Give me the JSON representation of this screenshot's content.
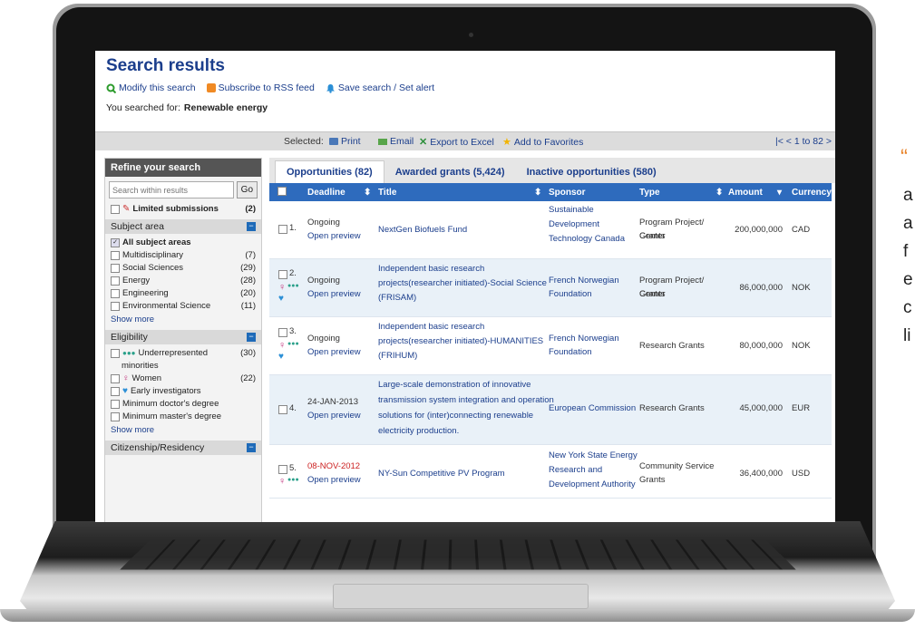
{
  "page": {
    "title": "Search results",
    "links": [
      "Modify this search",
      "Subscribe to RSS feed",
      "Save search / Set alert"
    ],
    "searched_for_label": "You searched for:",
    "searched_for_value": "Renewable energy"
  },
  "selbar": {
    "label": "Selected:",
    "actions": [
      "Print",
      "Email",
      "Export to Excel",
      "Add to Favorites"
    ],
    "pager": "|<  <  1 to 82  >"
  },
  "sidebar": {
    "heading": "Refine your search",
    "search_placeholder": "Search within results",
    "go": "Go",
    "limited": {
      "label": "Limited submissions",
      "count": "(2)"
    },
    "subject_area": {
      "title": "Subject area",
      "all": "All subject areas",
      "items": [
        {
          "label": "Multidisciplinary",
          "count": "(7)"
        },
        {
          "label": "Social Sciences",
          "count": "(29)"
        },
        {
          "label": "Energy",
          "count": "(28)"
        },
        {
          "label": "Engineering",
          "count": "(20)"
        },
        {
          "label": "Environmental Science",
          "count": "(11)"
        }
      ],
      "show_more": "Show more"
    },
    "eligibility": {
      "title": "Eligibility",
      "items": [
        {
          "label": "Underrepresented",
          "label2": "minorities",
          "count": "(30)"
        },
        {
          "label": "Women",
          "count": "(22)"
        },
        {
          "label": "Early investigators",
          "count": ""
        },
        {
          "label": "Minimum doctor's degree",
          "count": ""
        },
        {
          "label": "Minimum master's degree",
          "count": ""
        }
      ],
      "show_more": "Show more"
    },
    "citizenship": {
      "title": "Citizenship/Residency"
    }
  },
  "tabs": [
    "Opportunities (82)",
    "Awarded grants (5,424)",
    "Inactive opportunities (580)"
  ],
  "columns": [
    "Deadline",
    "Title",
    "Sponsor",
    "Type",
    "Amount",
    "Currency"
  ],
  "rows": [
    {
      "num": "1.",
      "deadline": "Ongoing",
      "preview": "Open preview",
      "title": [
        "NextGen Biofuels Fund"
      ],
      "sponsor": [
        "Sustainable",
        "Development",
        "Technology Canada"
      ],
      "type": [
        "Program Project/ Center",
        "Grants"
      ],
      "amount": "200,000,000",
      "currency": "CAD"
    },
    {
      "num": "2.",
      "deadline": "Ongoing",
      "preview": "Open preview",
      "title": [
        "Independent basic research",
        "projects(researcher initiated)-Social Science",
        "(FRISAM)"
      ],
      "sponsor": [
        "French Norwegian",
        "Foundation"
      ],
      "type": [
        "Program Project/ Center",
        "Grants"
      ],
      "amount": "86,000,000",
      "currency": "NOK"
    },
    {
      "num": "3.",
      "deadline": "Ongoing",
      "preview": "Open preview",
      "title": [
        "Independent basic research",
        "projects(researcher initiated)-HUMANITIES",
        "(FRIHUM)"
      ],
      "sponsor": [
        "French Norwegian",
        "Foundation"
      ],
      "type": [
        "Research Grants"
      ],
      "amount": "80,000,000",
      "currency": "NOK"
    },
    {
      "num": "4.",
      "deadline": "24-JAN-2013",
      "preview": "Open preview",
      "title": [
        "Large-scale demonstration of innovative",
        "transmission system integration and operation",
        "solutions for (inter)connecting renewable",
        "electricity production."
      ],
      "sponsor": [
        "European Commission"
      ],
      "type": [
        "Research Grants"
      ],
      "amount": "45,000,000",
      "currency": "EUR"
    },
    {
      "num": "5.",
      "deadline": "08-NOV-2012",
      "preview": "Open preview",
      "title": [
        "NY-Sun Competitive PV Program"
      ],
      "sponsor": [
        "New York State Energy",
        "Research and",
        "Development Authority"
      ],
      "type": [
        "Community Service",
        "Grants"
      ],
      "amount": "36,400,000",
      "currency": "USD"
    }
  ],
  "side_text": {
    "quote": "“",
    "letters": [
      "a",
      "a",
      "f",
      "e",
      "c",
      "li"
    ]
  },
  "colors": {
    "brand_blue": "#1b3e8c",
    "header_blue": "#2e6bbd",
    "deadline_red": "#cc2222",
    "quote_orange": "#e8842a"
  }
}
